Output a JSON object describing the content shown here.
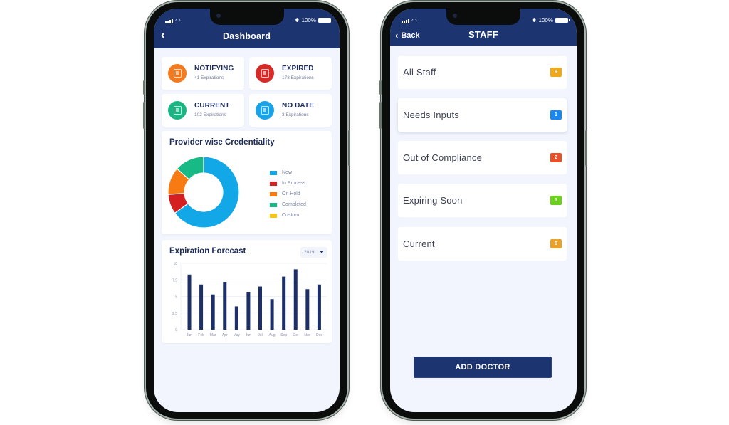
{
  "status_bar": {
    "battery": "100%",
    "bluetooth_icon": "bluetooth-icon",
    "wifi_icon": "wifi-icon",
    "signal_icon": "signal-icon"
  },
  "dashboard": {
    "title": "Dashboard",
    "back_icon": "chevron-left-icon",
    "stats": [
      {
        "title": "NOTIFYING",
        "subtitle": "41 Expirations",
        "color": "#f47a1f",
        "icon": "document-icon"
      },
      {
        "title": "EXPIRED",
        "subtitle": "178 Expirations",
        "color": "#d62a27",
        "icon": "document-icon"
      },
      {
        "title": "CURRENT",
        "subtitle": "102 Expirations",
        "color": "#1bb583",
        "icon": "document-icon"
      },
      {
        "title": "NO DATE",
        "subtitle": "3 Expirations",
        "color": "#1aa3e8",
        "icon": "document-icon"
      }
    ],
    "credentiality": {
      "title": "Provider wise Credentiality"
    },
    "forecast": {
      "title": "Expiration Forecast",
      "year_selected": "2019"
    }
  },
  "chart_data": [
    {
      "type": "pie",
      "title": "Provider wise Credentiality",
      "donut": true,
      "categories": [
        "New",
        "In Process",
        "On Hold",
        "Completed",
        "Custom"
      ],
      "values": [
        65,
        9,
        12.5,
        13.5,
        0
      ],
      "colors": [
        "#12a8e8",
        "#d42020",
        "#f77a12",
        "#17b985",
        "#f8c21c"
      ],
      "legend": "right"
    },
    {
      "type": "bar",
      "title": "Expiration Forecast",
      "categories": [
        "Jan",
        "Feb",
        "Mar",
        "Apr",
        "May",
        "Jun",
        "Jul",
        "Aug",
        "Sep",
        "Oct",
        "Nov",
        "Dec"
      ],
      "values": [
        8.3,
        6.8,
        5.3,
        7.2,
        3.5,
        5.7,
        6.5,
        4.6,
        8.0,
        9.1,
        6.1,
        6.8
      ],
      "yticks": [
        "0",
        "2.5",
        "5",
        "7.5",
        "10"
      ],
      "ylim": [
        0,
        10
      ],
      "xlabel": "",
      "ylabel": "",
      "grid": true,
      "bar_color": "#1c2f66"
    }
  ],
  "staff": {
    "title": "STAFF",
    "back_label": "Back",
    "back_icon": "chevron-left-icon",
    "rows": [
      {
        "label": "All Staff",
        "count": "9",
        "color": "#f0a818"
      },
      {
        "label": "Needs Inputs",
        "count": "1",
        "color": "#1a86f0"
      },
      {
        "label": "Out of Compliance",
        "count": "2",
        "color": "#e8502a"
      },
      {
        "label": "Expiring Soon",
        "count": "1",
        "color": "#6cd11c"
      },
      {
        "label": "Current",
        "count": "6",
        "color": "#eaa12a"
      }
    ],
    "add_button": "ADD DOCTOR"
  }
}
